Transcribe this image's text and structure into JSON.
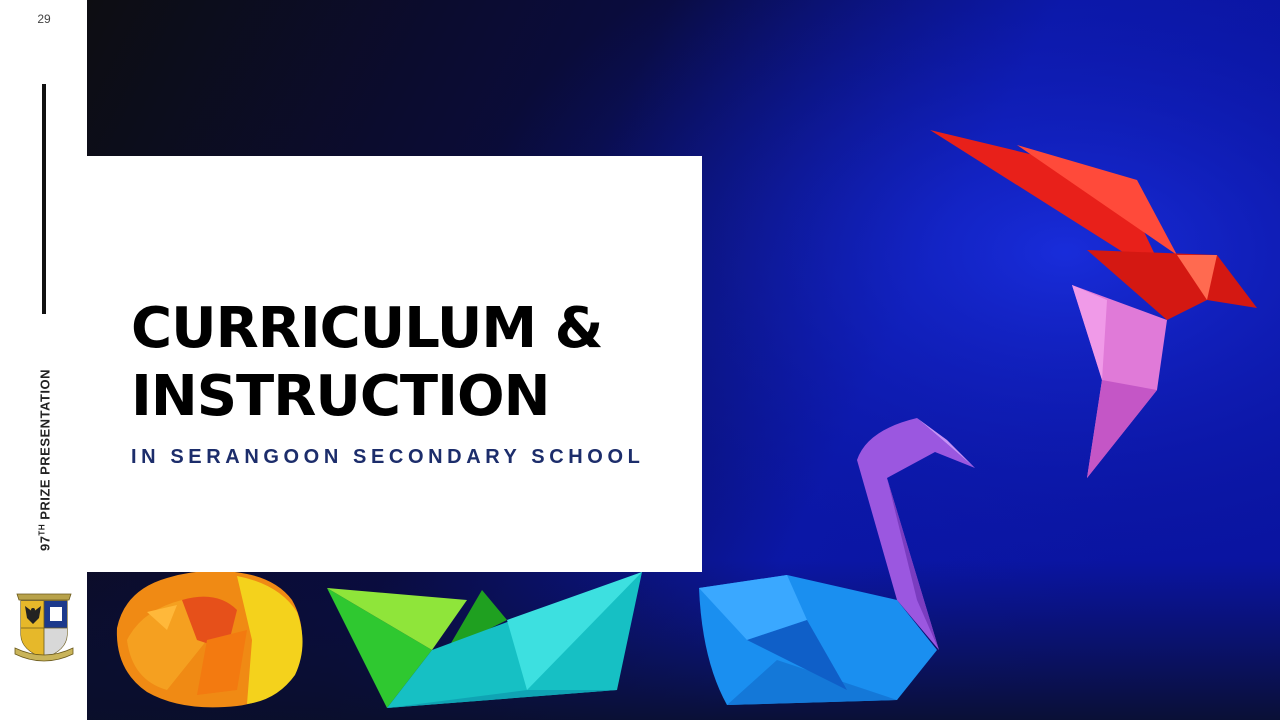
{
  "slide": {
    "number": "29",
    "side_label_prefix": "97",
    "side_label_sup": "TH",
    "side_label_rest": " PRIZE PRESENTATION",
    "title_line_1": "CURRICULUM &",
    "title_line_2": "INSTRUCTION",
    "subtitle": "IN SERANGOON SECONDARY SCHOOL"
  },
  "logo": {
    "name": "school-crest",
    "banner_text": "Serangoon Secondary School",
    "motto_text": "Seek Strive Serve"
  },
  "colors": {
    "subtitle": "#1c2d6b",
    "photo_bg_dark": "#0d0d14",
    "photo_bg_blue": "#0a1aa8"
  }
}
